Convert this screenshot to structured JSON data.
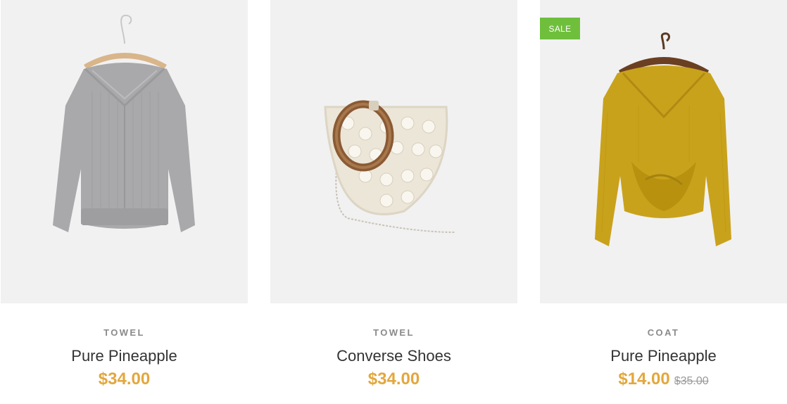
{
  "products": [
    {
      "image": "grey-knit-sweater-on-hanger",
      "badge": "",
      "category": "TOWEL",
      "name": "Pure Pineapple",
      "price": "$34.00",
      "old_price": ""
    },
    {
      "image": "white-beaded-half-moon-handbag",
      "badge": "",
      "category": "TOWEL",
      "name": "Converse Shoes",
      "price": "$34.00",
      "old_price": ""
    },
    {
      "image": "mustard-twist-front-sweater-on-hanger",
      "badge": "SALE",
      "category": "COAT",
      "name": "Pure Pineapple",
      "price": "$14.00",
      "old_price": "$35.00"
    }
  ],
  "colors": {
    "image_bg": "#f1f1f2",
    "sale_badge": "#6fbf3c",
    "price": "#e3a73d",
    "category": "#8a8a8a",
    "name": "#333333"
  }
}
